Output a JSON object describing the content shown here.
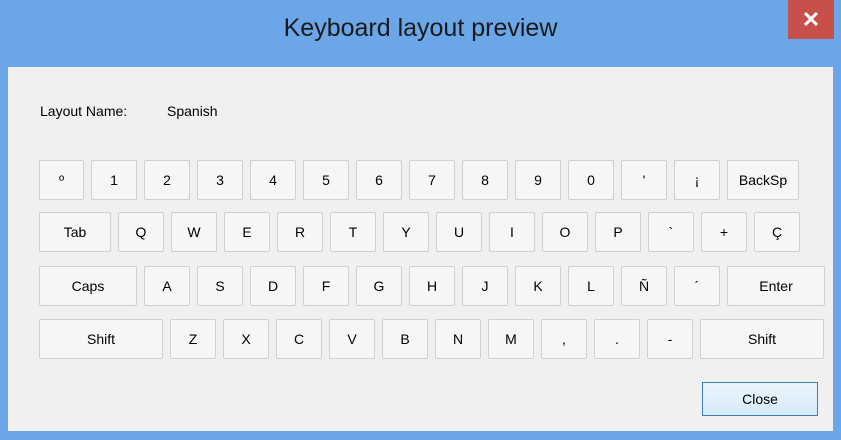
{
  "window": {
    "title": "Keyboard layout preview",
    "close_glyph": "✕",
    "frame_color": "#6aa6e8",
    "close_color": "#c7504a"
  },
  "layout": {
    "label": "Layout Name:",
    "value": "Spanish"
  },
  "keyboard": {
    "rows": [
      [
        "º",
        "1",
        "2",
        "3",
        "4",
        "5",
        "6",
        "7",
        "8",
        "9",
        "0",
        "'",
        "¡",
        "BackSp"
      ],
      [
        "Tab",
        "Q",
        "W",
        "E",
        "R",
        "T",
        "Y",
        "U",
        "I",
        "O",
        "P",
        "`",
        "+",
        "Ç"
      ],
      [
        "Caps",
        "A",
        "S",
        "D",
        "F",
        "G",
        "H",
        "J",
        "K",
        "L",
        "Ñ",
        "´",
        "Enter"
      ],
      [
        "Shift",
        "Z",
        "X",
        "C",
        "V",
        "B",
        "N",
        "M",
        ",",
        ".",
        "-",
        "Shift"
      ]
    ]
  },
  "footer": {
    "close_label": "Close"
  }
}
